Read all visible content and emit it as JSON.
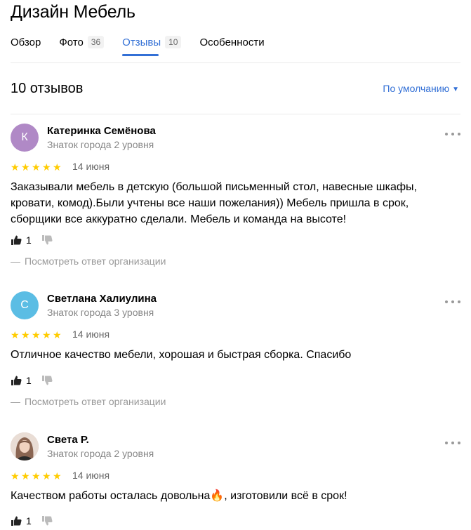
{
  "header": {
    "title": "Дизайн Мебель"
  },
  "tabs": [
    {
      "label": "Обзор",
      "count": ""
    },
    {
      "label": "Фото",
      "count": "36"
    },
    {
      "label": "Отзывы",
      "count": "10"
    },
    {
      "label": "Особенности",
      "count": ""
    }
  ],
  "reviews_header": {
    "count_label": "10 отзывов",
    "sort_label": "По умолчанию"
  },
  "colors": {
    "accent": "#3370d6",
    "star": "#ffcc00"
  },
  "reviews": [
    {
      "initial": "К",
      "avatar_color": "#b089c6",
      "author": "Катеринка Семёнова",
      "level": "Знаток города 2 уровня",
      "rating": 5,
      "date": "14 июня",
      "text": "Заказывали мебель в детскую (большой письменный стол, навесные шкафы, кровати, комод).Были учтены все наши пожелания)) Мебель пришла в срок, сборщики все аккуратно сделали. Мебель и команда на высоте!",
      "likes": "1",
      "org_link": "Посмотреть ответ организации"
    },
    {
      "initial": "С",
      "avatar_color": "#5bbde4",
      "author": "Светлана Халиулина",
      "level": "Знаток города 3 уровня",
      "rating": 5,
      "date": "14 июня",
      "text": "Отличное качество мебели, хорошая и быстрая сборка. Спасибо",
      "likes": "1",
      "org_link": "Посмотреть ответ организации"
    },
    {
      "initial": "",
      "avatar_color": "#c9a89a",
      "author": "Света Р.",
      "level": "Знаток города 2 уровня",
      "rating": 5,
      "date": "14 июня",
      "text": "Качеством работы осталась довольна🔥, изготовили всё в срок!",
      "likes": "1",
      "org_link": ""
    }
  ]
}
